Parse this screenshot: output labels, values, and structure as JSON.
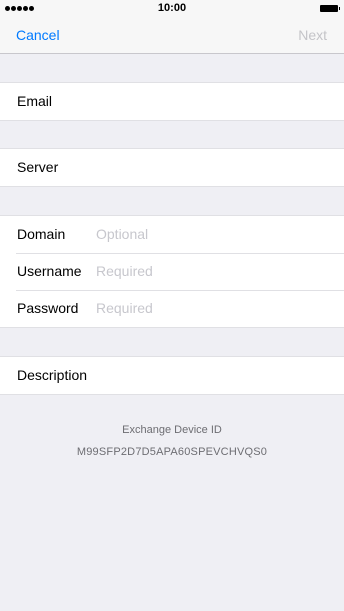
{
  "status_bar": {
    "time": "10:00",
    "signal_icon": "signal-dots-icon",
    "battery_icon": "battery-icon"
  },
  "nav": {
    "cancel_label": "Cancel",
    "next_label": "Next",
    "accent_color": "#007aff",
    "disabled_color": "#c4c4c8"
  },
  "form": {
    "email": {
      "label": "Email"
    },
    "server": {
      "label": "Server"
    },
    "domain": {
      "label": "Domain",
      "placeholder": "Optional"
    },
    "username": {
      "label": "Username",
      "placeholder": "Required"
    },
    "password": {
      "label": "Password",
      "placeholder": "Required"
    },
    "description": {
      "label": "Description"
    }
  },
  "device": {
    "label": "Exchange Device ID",
    "value": "M99SFP2D7D5APA60SPEVCHVQS0"
  }
}
